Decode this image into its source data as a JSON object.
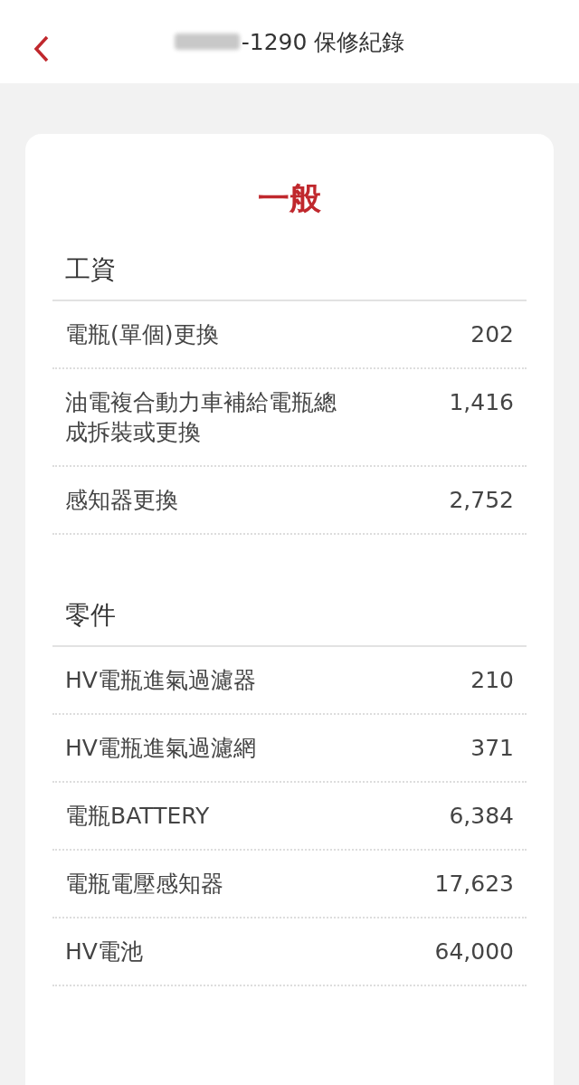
{
  "header": {
    "title": "-1290 保修紀錄"
  },
  "card": {
    "title": "一般",
    "sections": [
      {
        "heading": "工資",
        "items": [
          {
            "name": "電瓶(單個)更換",
            "amount": "202"
          },
          {
            "name": "油電複合動力車補給電瓶總成拆裝或更換",
            "amount": "1,416"
          },
          {
            "name": "感知器更換",
            "amount": "2,752"
          }
        ]
      },
      {
        "heading": "零件",
        "items": [
          {
            "name": "HV電瓶進氣過濾器",
            "amount": "210"
          },
          {
            "name": "HV電瓶進氣過濾網",
            "amount": "371"
          },
          {
            "name": "電瓶BATTERY",
            "amount": "6,384"
          },
          {
            "name": "電瓶電壓感知器",
            "amount": "17,623"
          },
          {
            "name": "HV電池",
            "amount": "64,000"
          }
        ]
      }
    ]
  }
}
